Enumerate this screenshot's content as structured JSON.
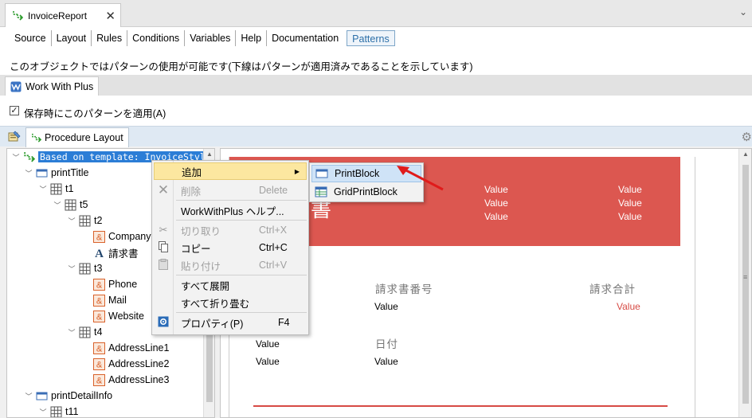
{
  "window": {
    "doc_tab": "InvoiceReport",
    "close_glyph": "✕",
    "overflow_glyph": "⌄"
  },
  "view_tabs": [
    {
      "label": "Source"
    },
    {
      "label": "Layout"
    },
    {
      "label": "Rules"
    },
    {
      "label": "Conditions"
    },
    {
      "label": "Variables"
    },
    {
      "label": "Help"
    },
    {
      "label": "Documentation"
    },
    {
      "label": "Patterns",
      "active": true
    }
  ],
  "info_text": "このオブジェクトではパターンの使用が可能です(下線はパターンが適用済みであることを示しています)",
  "pattern_tab": "Work With Plus",
  "apply_checkbox": {
    "label": "保存時にこのパターンを適用(A)",
    "checked": true
  },
  "layout_tab": "Procedure Layout",
  "tree": [
    {
      "label": "Based on template: InvoiceStyle",
      "icon": "template-icon",
      "selected": true
    },
    {
      "label": "printTitle",
      "icon": "printblock-icon"
    },
    {
      "label": "t1",
      "icon": "table-icon"
    },
    {
      "label": "t5",
      "icon": "table-icon"
    },
    {
      "label": "t2",
      "icon": "table-icon"
    },
    {
      "label": "Company",
      "icon": "attribute-icon"
    },
    {
      "label": "請求書",
      "icon": "textblock-icon"
    },
    {
      "label": "t3",
      "icon": "table-icon"
    },
    {
      "label": "Phone",
      "icon": "attribute-icon"
    },
    {
      "label": "Mail",
      "icon": "attribute-icon"
    },
    {
      "label": "Website",
      "icon": "attribute-icon"
    },
    {
      "label": "t4",
      "icon": "table-icon"
    },
    {
      "label": "AddressLine1",
      "icon": "attribute-icon"
    },
    {
      "label": "AddressLine2",
      "icon": "attribute-icon"
    },
    {
      "label": "AddressLine3",
      "icon": "attribute-icon"
    },
    {
      "label": "printDetailInfo",
      "icon": "printblock-icon"
    },
    {
      "label": "t11",
      "icon": "table-icon"
    }
  ],
  "context_menu": {
    "items": [
      {
        "label": "追加",
        "has_submenu": true,
        "highlighted": true
      },
      {
        "label": "削除",
        "shortcut": "Delete",
        "disabled": true,
        "icon": "delete-icon"
      },
      {
        "label": "WorkWithPlus ヘルプ..."
      },
      {
        "label": "切り取り",
        "shortcut": "Ctrl+X",
        "disabled": true,
        "icon": "cut-icon"
      },
      {
        "label": "コピー",
        "shortcut": "Ctrl+C",
        "icon": "copy-icon"
      },
      {
        "label": "貼り付け",
        "shortcut": "Ctrl+V",
        "disabled": true,
        "icon": "paste-icon"
      },
      {
        "label": "すべて展開"
      },
      {
        "label": "すべて折り畳む"
      },
      {
        "label": "プロパティ(P)",
        "shortcut": "F4",
        "icon": "properties-icon"
      }
    ],
    "submenu": [
      {
        "label": "PrintBlock",
        "icon": "printblock-icon",
        "highlighted": true
      },
      {
        "label": "GridPrintBlock",
        "icon": "gridprintblock-icon"
      }
    ]
  },
  "canvas": {
    "header_title_fragment": "書",
    "header_values": [
      "Value",
      "Value",
      "Value",
      "Value",
      "Value",
      "Value"
    ],
    "invoice_number_label": "請求書番号",
    "invoice_total_label": "請求合計",
    "date_label": "日付",
    "invoice_number_value": "Value",
    "invoice_total_value": "Value",
    "left_value_1": "Value",
    "left_value_2": "Value",
    "date_value": "Value",
    "accent_color": "#dc5750"
  }
}
